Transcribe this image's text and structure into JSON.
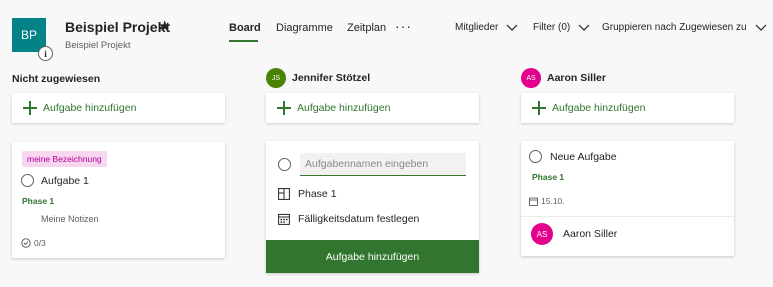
{
  "project": {
    "initials": "BP",
    "info_glyph": "i",
    "title": "Beispiel Projekt",
    "subtitle": "Beispiel Projekt",
    "star_icon": "star-icon"
  },
  "tabs": [
    {
      "label": "Board",
      "active": true
    },
    {
      "label": "Diagramme",
      "active": false
    },
    {
      "label": "Zeitplan",
      "active": false
    }
  ],
  "more_label": "···",
  "menus": {
    "members": "Mitglieder",
    "filter": "Filter (0)",
    "group": "Gruppieren nach Zugewiesen zu"
  },
  "columns": [
    {
      "title": "Nicht zugewiesen"
    },
    {
      "title": "Jennifer Stötzel",
      "avatar": "JS"
    },
    {
      "title": "Aaron Siller",
      "avatar": "AS"
    }
  ],
  "add_task_label": "Aufgabe hinzufügen",
  "card1": {
    "label": "meine Bezeichnung",
    "title": "Aufgabe 1",
    "phase": "Phase 1",
    "notes": "Meine Notizen",
    "checklist": "0/3"
  },
  "new_task_form": {
    "placeholder": "Aufgabennamen eingeben",
    "bucket": "Phase 1",
    "due_date": "Fälligkeitsdatum festlegen",
    "submit": "Aufgabe hinzufügen"
  },
  "card3": {
    "title": "Neue Aufgabe",
    "phase": "Phase 1",
    "date": "15.10.",
    "assignee_initials": "AS",
    "assignee_name": "Aaron Siller"
  },
  "colors": {
    "accent": "#31752f",
    "tile": "#038387",
    "avatar_js": "#498205",
    "avatar_as": "#e3008c",
    "chip_bg": "#f7d6ef",
    "chip_text": "#b4009e"
  }
}
